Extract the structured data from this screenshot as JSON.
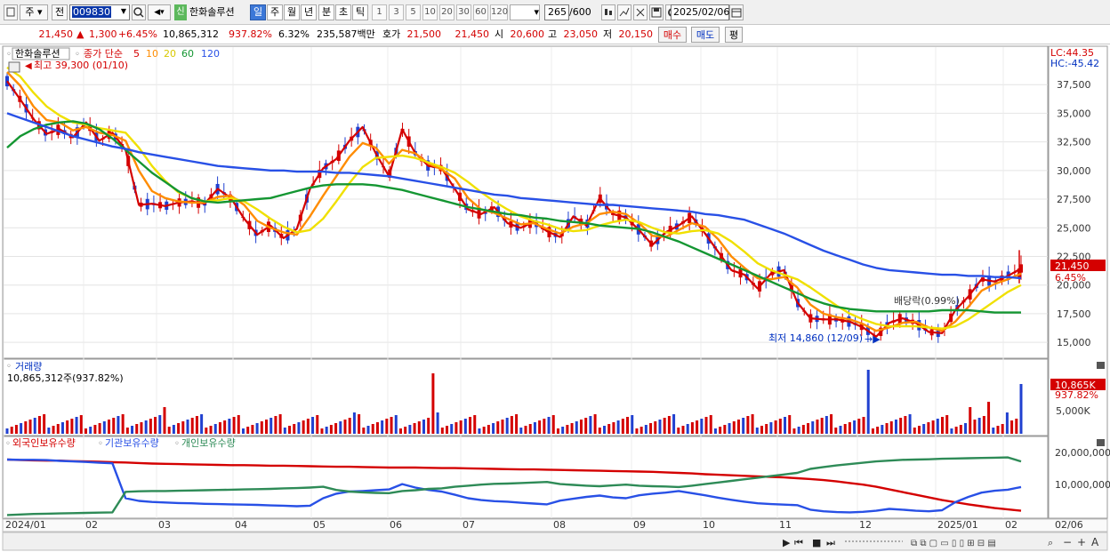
{
  "toolbar": {
    "period_prefix": "주",
    "prev_label": "전",
    "stock_code": "009830",
    "new_badge": "신",
    "stock_name": "한화솔루션",
    "periods": [
      "일",
      "주",
      "월",
      "년",
      "분",
      "초",
      "틱"
    ],
    "active_period": "일",
    "intervals": [
      "1",
      "3",
      "5",
      "10",
      "20",
      "30",
      "60",
      "120"
    ],
    "bar_count": "265",
    "bar_total": "/600",
    "date": "2025/02/06"
  },
  "quote": {
    "price": "21,450",
    "change": "1,300",
    "change_pct": "+6.45%",
    "volume": "10,865,312",
    "volume_ratio": "937.82%",
    "turnover": "6.32%",
    "amount": "235,587백만",
    "ask_label": "호가",
    "ask": "21,500",
    "bid": "21,450",
    "open_label": "시",
    "open": "20,600",
    "high_label": "고",
    "high": "23,050",
    "low_label": "저",
    "low": "20,150",
    "buy_button": "매수",
    "sell_button": "매도",
    "eval_button": "평"
  },
  "price_panel": {
    "name": "한화솔루션",
    "ma_title": "종가 단순",
    "ma_periods": [
      "5",
      "10",
      "20",
      "60",
      "120"
    ],
    "ma_colors": [
      "#d40000",
      "#ff8c00",
      "#f0e000",
      "#149632",
      "#2850e6"
    ],
    "high_note": "최고 39,300 (01/10)",
    "low_note": "최저 14,860 (12/09)",
    "dividend_note": "배당락(0.99%)",
    "lc": "LC:44.35",
    "hc": "HC:-45.42",
    "current_price": "21,450",
    "current_pct": "6.45%",
    "y_ticks": [
      "37,500",
      "35,000",
      "32,500",
      "30,000",
      "27,500",
      "25,000",
      "22,500",
      "20,000",
      "17,500",
      "15,000"
    ]
  },
  "volume_panel": {
    "title": "거래량",
    "value": "10,865,312주(937.82%)",
    "current": "10,865K",
    "current_pct": "937.82%",
    "y_tick": "5,000K"
  },
  "holding_panel": {
    "legends": [
      "외국인보유수량",
      "기관보유수량",
      "개인보유수량"
    ],
    "colors": [
      "#d40000",
      "#2850e6",
      "#2e8b57"
    ],
    "y_ticks": [
      "20,000,000",
      "10,000,000"
    ]
  },
  "x_axis": {
    "labels": [
      "2024/01",
      "02",
      "03",
      "04",
      "05",
      "06",
      "07",
      "08",
      "09",
      "10",
      "11",
      "12",
      "2025/01",
      "02"
    ],
    "right_label": "02/06"
  },
  "chart_data": {
    "type": "candlestick",
    "title": "한화솔루션",
    "price_ylim": [
      14000,
      39300
    ],
    "price_series": [
      {
        "name": "5",
        "values": [
          37800,
          36200,
          34500,
          33200,
          33600,
          32900,
          34200,
          32600,
          33300,
          31800,
          27000,
          27100,
          26900,
          27200,
          27300,
          27100,
          28400,
          27600,
          25800,
          24400,
          25200,
          24100,
          24900,
          28400,
          30200,
          31000,
          32600,
          33800,
          31500,
          29500,
          33600,
          31500,
          30400,
          30200,
          28400,
          26600,
          26200,
          26800,
          25400,
          25000,
          25500,
          24700,
          24200,
          26000,
          25200,
          27600,
          26200,
          25900,
          24800,
          23500,
          24600,
          25200,
          26000,
          24500,
          22900,
          21300,
          20900,
          19700,
          21000,
          21300,
          18500,
          17100,
          17000,
          17000,
          16800,
          16300,
          15500,
          16700,
          17100,
          16700,
          15900,
          15800,
          17800,
          19000,
          20500,
          20300,
          20800,
          21450
        ]
      },
      {
        "name": "10",
        "values": [
          38600,
          37400,
          35600,
          34400,
          34200,
          33500,
          33800,
          33300,
          33100,
          32600,
          30000,
          28200,
          27600,
          27300,
          27200,
          27200,
          27700,
          27800,
          27000,
          25600,
          25000,
          24600,
          24400,
          26000,
          27800,
          29500,
          31200,
          32400,
          32000,
          30600,
          31800,
          31500,
          30600,
          30100,
          29300,
          27600,
          26600,
          26300,
          25800,
          25300,
          25400,
          24900,
          24500,
          25100,
          25400,
          26200,
          26400,
          26200,
          25400,
          24300,
          24200,
          24800,
          25400,
          25100,
          24000,
          22500,
          21500,
          20600,
          20500,
          20700,
          19800,
          18300,
          17500,
          17200,
          17000,
          16600,
          16000,
          16300,
          16700,
          16800,
          16300,
          16000,
          16800,
          18100,
          19500,
          20100,
          20500,
          21000
        ]
      },
      {
        "name": "20",
        "values": [
          39000,
          38200,
          36800,
          35600,
          34800,
          34200,
          34000,
          33700,
          33500,
          33300,
          32000,
          30400,
          29100,
          28100,
          27600,
          27300,
          27400,
          27600,
          27300,
          26600,
          25800,
          25100,
          24600,
          24800,
          25800,
          27300,
          28900,
          30300,
          31100,
          31200,
          31300,
          31100,
          30700,
          30300,
          29800,
          29000,
          28100,
          27300,
          26600,
          26000,
          25600,
          25300,
          24900,
          24700,
          24800,
          25200,
          25500,
          25700,
          25500,
          25000,
          24600,
          24500,
          24700,
          24800,
          24500,
          23800,
          22900,
          21900,
          21300,
          20900,
          20500,
          19800,
          19000,
          18200,
          17500,
          17000,
          16600,
          16400,
          16400,
          16400,
          16300,
          16200,
          16400,
          17000,
          17800,
          18600,
          19400,
          20000
        ]
      },
      {
        "name": "60",
        "values": [
          32000,
          33000,
          33600,
          34000,
          34200,
          34300,
          34100,
          33600,
          32800,
          31800,
          30800,
          29800,
          29000,
          28200,
          27600,
          27300,
          27200,
          27300,
          27400,
          27500,
          27600,
          27900,
          28200,
          28500,
          28700,
          28800,
          28800,
          28800,
          28700,
          28500,
          28300,
          28000,
          27700,
          27400,
          27100,
          26800,
          26600,
          26400,
          26200,
          26100,
          25900,
          25800,
          25600,
          25500,
          25400,
          25200,
          25100,
          25000,
          24900,
          24600,
          24200,
          23800,
          23300,
          22800,
          22300,
          21800,
          21300,
          20800,
          20300,
          19800,
          19300,
          18800,
          18400,
          18100,
          17900,
          17800,
          17700,
          17700,
          17700,
          17700,
          17700,
          17800,
          17800,
          17800,
          17700,
          17600,
          17600,
          17600
        ]
      },
      {
        "name": "120",
        "values": [
          35000,
          34600,
          34200,
          33800,
          33400,
          33000,
          32700,
          32400,
          32100,
          31900,
          31600,
          31400,
          31200,
          31000,
          30800,
          30600,
          30400,
          30300,
          30200,
          30100,
          30000,
          30000,
          29900,
          29900,
          29900,
          29800,
          29800,
          29700,
          29600,
          29500,
          29300,
          29100,
          28900,
          28700,
          28500,
          28300,
          28100,
          27900,
          27800,
          27600,
          27500,
          27400,
          27300,
          27200,
          27100,
          27000,
          27000,
          26900,
          26800,
          26700,
          26600,
          26500,
          26400,
          26200,
          26100,
          25900,
          25700,
          25300,
          24900,
          24500,
          24000,
          23500,
          23000,
          22600,
          22200,
          21800,
          21500,
          21300,
          21200,
          21100,
          21000,
          20900,
          20900,
          20800,
          20800,
          20700,
          20700,
          20600
        ]
      }
    ],
    "holding_ylim": [
      0,
      25000000
    ],
    "holding_series": [
      {
        "name": "외국인보유수량",
        "values": [
          21000000,
          20800000,
          20700000,
          20600000,
          20600000,
          20400000,
          20300000,
          20200000,
          20000000,
          19900000,
          19700000,
          19500000,
          19400000,
          19300000,
          19200000,
          19100000,
          19000000,
          18900000,
          18900000,
          18800000,
          18700000,
          18700000,
          18600000,
          18500000,
          18400000,
          18300000,
          18300000,
          18200000,
          18100000,
          18000000,
          18000000,
          18000000,
          17900000,
          17800000,
          17800000,
          17700000,
          17600000,
          17500000,
          17400000,
          17300000,
          17300000,
          17200000,
          17100000,
          17000000,
          16900000,
          16800000,
          16700000,
          16600000,
          16500000,
          16400000,
          16200000,
          16000000,
          15800000,
          15500000,
          15300000,
          15100000,
          14900000,
          14700000,
          14500000,
          14300000,
          14000000,
          13700000,
          13300000,
          12800000,
          12200000,
          11600000,
          10800000,
          9800000,
          8800000,
          7800000,
          6800000,
          5800000,
          5000000,
          4200000,
          3500000,
          2800000,
          2300000,
          1800000
        ]
      },
      {
        "name": "기관보유수량",
        "values": [
          21000000,
          20900000,
          20900000,
          20800000,
          20500000,
          20300000,
          20100000,
          19800000,
          19600000,
          6500000,
          5500000,
          5100000,
          4900000,
          4700000,
          4600000,
          4400000,
          4300000,
          4200000,
          4100000,
          4000000,
          3800000,
          3700000,
          3500000,
          3700000,
          6500000,
          8200000,
          9000000,
          9200000,
          9500000,
          9800000,
          11800000,
          10500000,
          9600000,
          9000000,
          7800000,
          6500000,
          5800000,
          5400000,
          5200000,
          4800000,
          4500000,
          4200000,
          5600000,
          6300000,
          7000000,
          7500000,
          6800000,
          6500000,
          7600000,
          8200000,
          8600000,
          9200000,
          8400000,
          7600000,
          6700000,
          5900000,
          5200000,
          4600000,
          4300000,
          4100000,
          3900000,
          2200000,
          1600000,
          1300000,
          1200000,
          1400000,
          1800000,
          2500000,
          2200000,
          1800000,
          1600000,
          2000000,
          5000000,
          7000000,
          8600000,
          9300000,
          9700000,
          10700000
        ]
      },
      {
        "name": "개인보유수량",
        "values": [
          200000,
          400000,
          600000,
          700000,
          800000,
          900000,
          1000000,
          1100000,
          1200000,
          8900000,
          9100000,
          9200000,
          9200000,
          9300000,
          9400000,
          9500000,
          9600000,
          9700000,
          9800000,
          9900000,
          10000000,
          10200000,
          10300000,
          10500000,
          10800000,
          9600000,
          9000000,
          8700000,
          8500000,
          8400000,
          9200000,
          9500000,
          10000000,
          10200000,
          10800000,
          11200000,
          11600000,
          11900000,
          12000000,
          12200000,
          12400000,
          12600000,
          11800000,
          11500000,
          11200000,
          11000000,
          11300000,
          11600000,
          11200000,
          11000000,
          10900000,
          10700000,
          11200000,
          11800000,
          12400000,
          13000000,
          13600000,
          14200000,
          14800000,
          15400000,
          16000000,
          17500000,
          18200000,
          18800000,
          19300000,
          19800000,
          20300000,
          20600000,
          20900000,
          21000000,
          21100000,
          21300000,
          21400000,
          21500000,
          21600000,
          21700000,
          21800000,
          20300000
        ]
      }
    ],
    "volume_spikes": [
      "937.82%"
    ]
  }
}
